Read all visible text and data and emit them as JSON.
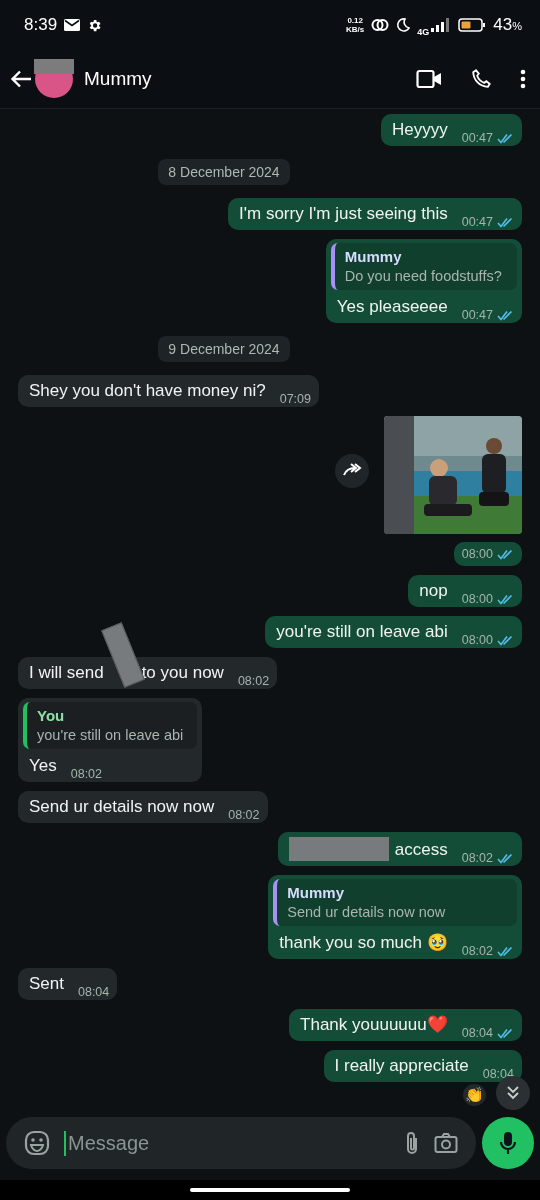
{
  "status_bar": {
    "time": "8:39",
    "speed_value": "0.12",
    "speed_unit": "KB/s",
    "network": "4G",
    "battery": "43",
    "battery_unit": "%"
  },
  "header": {
    "contact": "Mummy"
  },
  "messages": [
    {
      "kind": "out",
      "text": "Heyyyy",
      "time": "00:47",
      "read": true
    },
    {
      "kind": "date",
      "text": "8 December 2024"
    },
    {
      "kind": "out",
      "text": "I'm sorry I'm just seeing this",
      "time": "00:47",
      "read": true
    },
    {
      "kind": "out",
      "quote": {
        "author": "Mummy",
        "text": "Do you need foodstuffs?",
        "self": false
      },
      "text": "Yes pleaseeee",
      "time": "00:47",
      "read": true
    },
    {
      "kind": "date",
      "text": "9 December 2024"
    },
    {
      "kind": "in",
      "text": "Shey you don't have money ni?",
      "time": "07:09"
    },
    {
      "time": "08:00",
      "read": true
    },
    {
      "kind": "out",
      "text": "nop",
      "time": "08:00",
      "read": true
    },
    {
      "kind": "out",
      "text": "you're still on leave abi",
      "time": "08:00",
      "read": true
    },
    {
      "kind": "in",
      "segments": [
        {
          "kind": "text",
          "text": "I will send"
        },
        {
          "kind": "redaction"
        },
        {
          "kind": "text",
          "text": "to you now"
        }
      ],
      "time": "08:02"
    },
    {
      "kind": "in",
      "quote": {
        "author": "You",
        "text": "you're still on leave abi",
        "self": true
      },
      "text": "Yes",
      "time": "08:02"
    },
    {
      "kind": "in",
      "text": "Send ur details now now",
      "time": "08:02"
    },
    {
      "kind": "out",
      "segments": [
        {
          "kind": "redaction"
        },
        {
          "kind": "text",
          "text": "access"
        }
      ],
      "time": "08:02",
      "read": true
    },
    {
      "kind": "out",
      "quote": {
        "author": "Mummy",
        "text": "Send ur details now now",
        "self": false
      },
      "text": "thank you so much 🥹",
      "time": "08:02",
      "read": true
    },
    {
      "kind": "in",
      "text": "Sent",
      "time": "08:04"
    },
    {
      "kind": "out",
      "text": "Thank youuuuuu❤️",
      "time": "08:04",
      "read": true
    },
    {
      "kind": "out",
      "text": "I really appreciate",
      "time": "08:04",
      "reaction": "👏"
    }
  ],
  "composer": {
    "placeholder": "Message"
  }
}
